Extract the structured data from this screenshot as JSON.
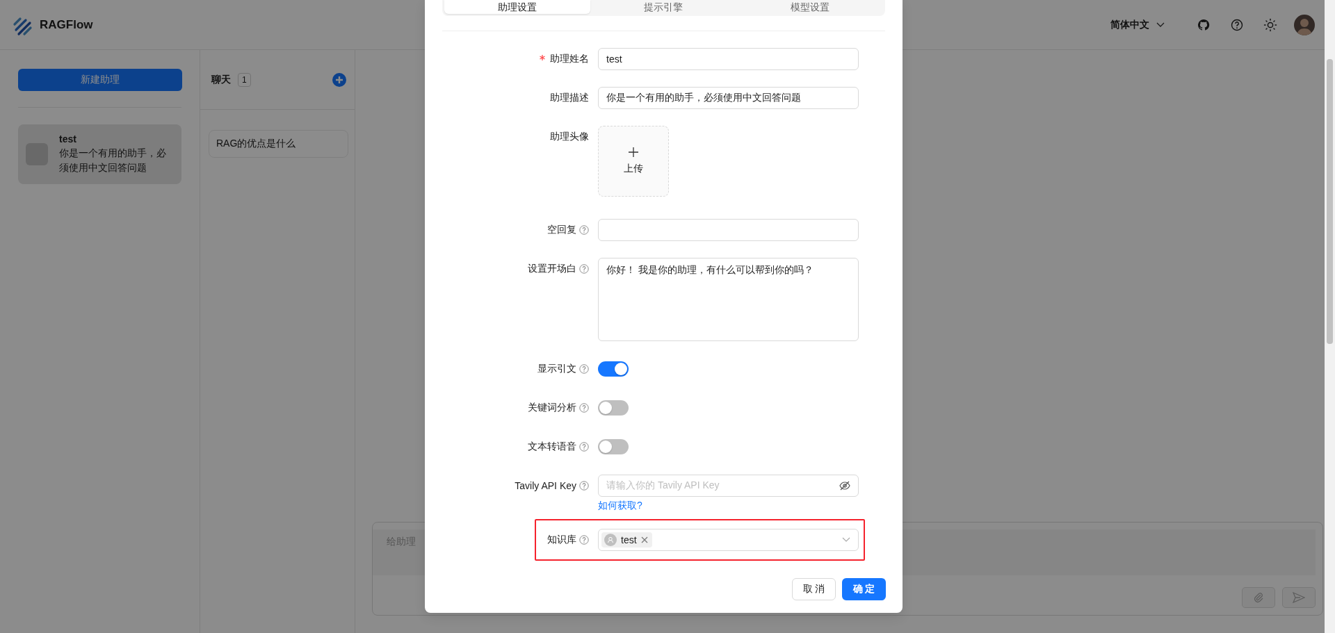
{
  "header": {
    "brand": "RAGFlow",
    "language": "简体中文"
  },
  "sidebar": {
    "new_button": "新建助理",
    "assistants": [
      {
        "name": "test",
        "description": "你是一个有用的助手，必须使用中文回答问题",
        "selected": true
      }
    ]
  },
  "chat_list": {
    "title": "聊天",
    "count": "1",
    "items": [
      {
        "title": "RAG的优点是什么",
        "selected": false
      }
    ]
  },
  "chat_input": {
    "placeholder": "给助理"
  },
  "dialog": {
    "tabs": [
      {
        "label": "助理设置",
        "selected": true
      },
      {
        "label": "提示引擎",
        "selected": false
      },
      {
        "label": "模型设置",
        "selected": false
      }
    ],
    "fields": [
      {
        "kind": "text",
        "label": "助理姓名",
        "required": true,
        "help": false,
        "value": "test"
      },
      {
        "kind": "text",
        "label": "助理描述",
        "required": false,
        "help": false,
        "value": "你是一个有用的助手，必须使用中文回答问题"
      },
      {
        "kind": "upload",
        "label": "助理头像",
        "required": false,
        "help": false,
        "button": "上传"
      },
      {
        "kind": "text",
        "label": "空回复",
        "required": false,
        "help": true
      },
      {
        "kind": "textarea",
        "label": "设置开场白",
        "required": false,
        "help": true,
        "value": "你好！ 我是你的助理，有什么可以帮到你的吗？"
      },
      {
        "kind": "switch",
        "label": "显示引文",
        "required": false,
        "help": true,
        "on": true
      },
      {
        "kind": "switch",
        "label": "关键词分析",
        "required": false,
        "help": true,
        "on": false
      },
      {
        "kind": "switch",
        "label": "文本转语音",
        "required": false,
        "help": true,
        "on": false
      },
      {
        "kind": "password",
        "label": "Tavily API Key",
        "required": false,
        "help": true,
        "placeholder": "请输入你的 Tavily API Key",
        "link": "如何获取?"
      },
      {
        "kind": "select",
        "label": "知识库",
        "required": false,
        "help": true,
        "tags": [
          "test"
        ],
        "highlighted": true
      }
    ],
    "buttons": [
      {
        "label": "取 消",
        "primary": false
      },
      {
        "label": "确 定",
        "primary": true
      }
    ]
  }
}
